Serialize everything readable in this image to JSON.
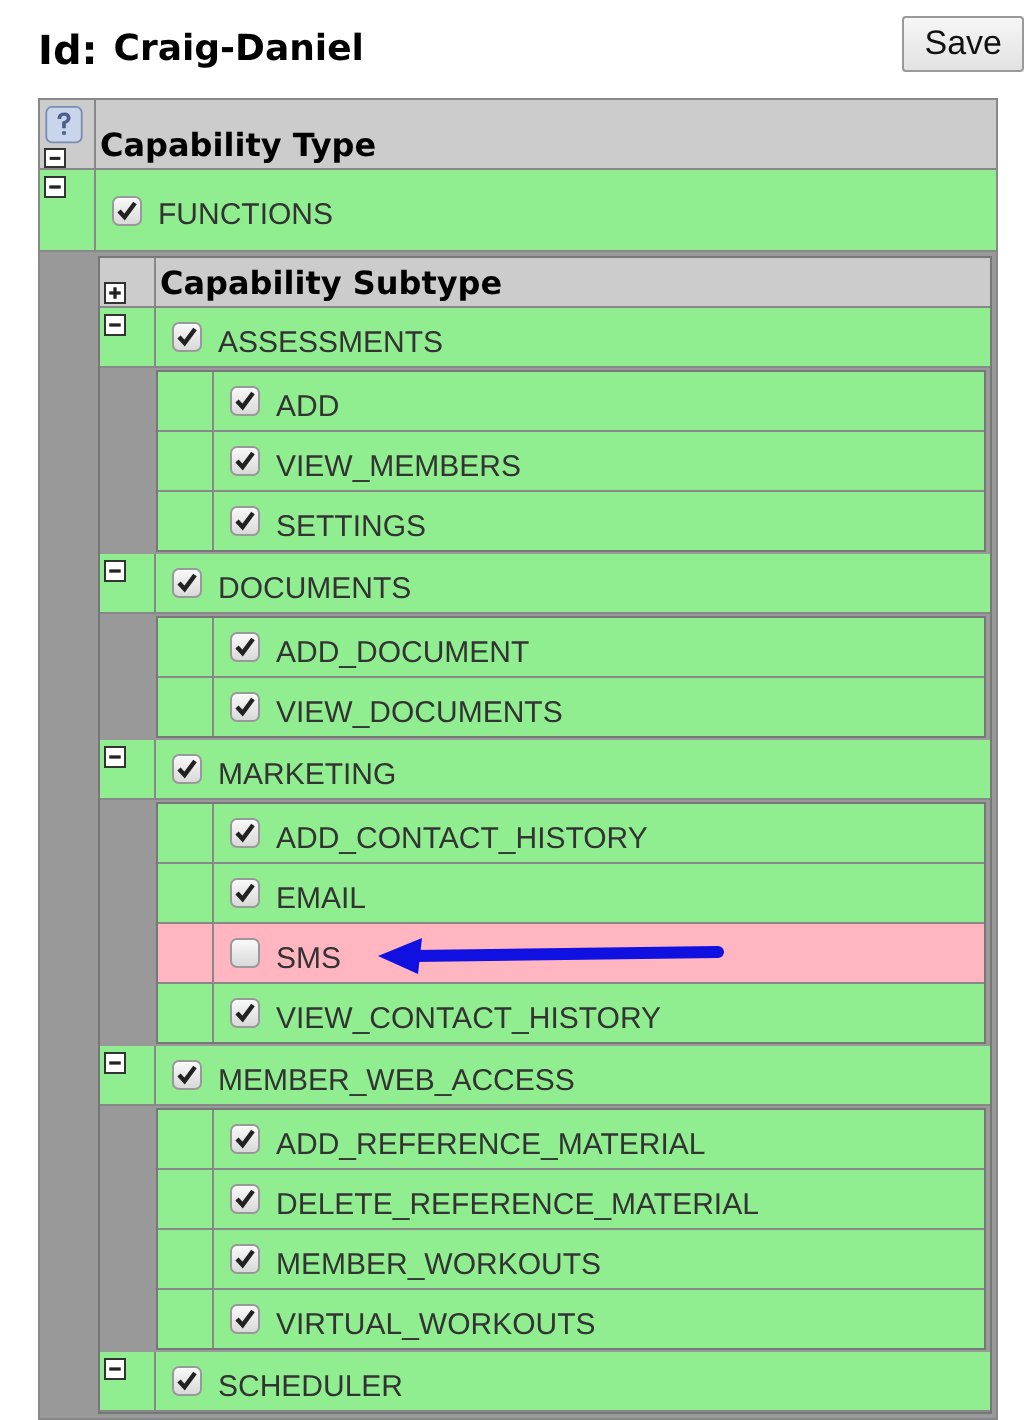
{
  "title": {
    "label": "Id:",
    "value": "Craig-Daniel"
  },
  "buttons": [
    "Save"
  ],
  "table": {
    "header": "Capability Type",
    "expanded": true,
    "types": [
      {
        "label": "FUNCTIONS",
        "checked": true,
        "expanded": true,
        "subtable": {
          "header": "Capability Subtype",
          "expanded": false,
          "categories": [
            {
              "label": "ASSESSMENTS",
              "checked": true,
              "expanded": true,
              "items": [
                {
                  "label": "ADD",
                  "checked": true,
                  "annotated": false
                },
                {
                  "label": "VIEW_MEMBERS",
                  "checked": true,
                  "annotated": false
                },
                {
                  "label": "SETTINGS",
                  "checked": true,
                  "annotated": false
                }
              ]
            },
            {
              "label": "DOCUMENTS",
              "checked": true,
              "expanded": true,
              "items": [
                {
                  "label": "ADD_DOCUMENT",
                  "checked": true,
                  "annotated": false
                },
                {
                  "label": "VIEW_DOCUMENTS",
                  "checked": true,
                  "annotated": false
                }
              ]
            },
            {
              "label": "MARKETING",
              "checked": true,
              "expanded": true,
              "items": [
                {
                  "label": "ADD_CONTACT_HISTORY",
                  "checked": true,
                  "annotated": false
                },
                {
                  "label": "EMAIL",
                  "checked": true,
                  "annotated": false
                },
                {
                  "label": "SMS",
                  "checked": false,
                  "annotated": true
                },
                {
                  "label": "VIEW_CONTACT_HISTORY",
                  "checked": true,
                  "annotated": false
                }
              ]
            },
            {
              "label": "MEMBER_WEB_ACCESS",
              "checked": true,
              "expanded": true,
              "items": [
                {
                  "label": "ADD_REFERENCE_MATERIAL",
                  "checked": true,
                  "annotated": false
                },
                {
                  "label": "DELETE_REFERENCE_MATERIAL",
                  "checked": true,
                  "annotated": false
                },
                {
                  "label": "MEMBER_WORKOUTS",
                  "checked": true,
                  "annotated": false
                },
                {
                  "label": "VIRTUAL_WORKOUTS",
                  "checked": true,
                  "annotated": false
                }
              ]
            },
            {
              "label": "SCHEDULER",
              "checked": true,
              "expanded": true
            }
          ]
        }
      }
    ]
  }
}
